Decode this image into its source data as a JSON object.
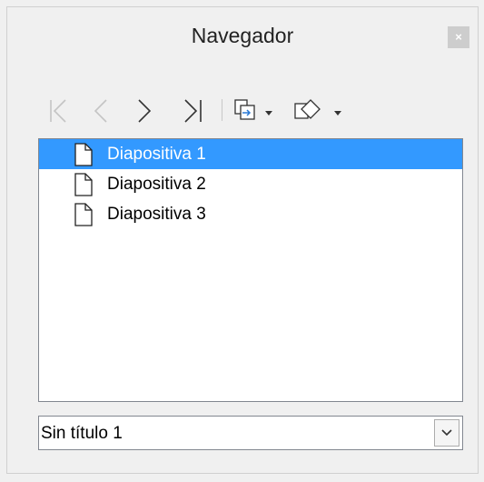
{
  "window": {
    "title": "Navegador",
    "close_label": "×"
  },
  "toolbar": {
    "buttons": [
      {
        "name": "first-slide",
        "icon": "first-icon"
      },
      {
        "name": "previous-slide",
        "icon": "previous-icon"
      },
      {
        "name": "next-slide",
        "icon": "next-icon"
      },
      {
        "name": "last-slide",
        "icon": "last-icon"
      },
      {
        "name": "drag-mode",
        "icon": "drag-mode-icon",
        "has_dropdown": true
      },
      {
        "name": "shapes",
        "icon": "shapes-icon",
        "has_dropdown": true
      }
    ]
  },
  "tree": {
    "items": [
      {
        "label": "Diapositiva 1",
        "icon": "slide-page-icon",
        "selected": true
      },
      {
        "label": "Diapositiva 2",
        "icon": "slide-page-icon",
        "selected": false
      },
      {
        "label": "Diapositiva 3",
        "icon": "slide-page-icon",
        "selected": false
      }
    ]
  },
  "document_select": {
    "value": "Sin título 1"
  },
  "colors": {
    "selection": "#3399ff",
    "background": "#f0f0f0",
    "close_button": "#cdcdcd"
  }
}
